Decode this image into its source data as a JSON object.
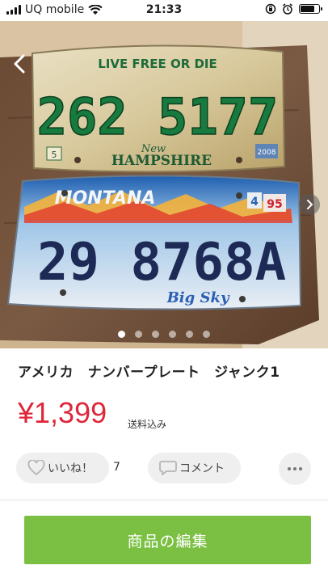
{
  "status_bar": {
    "carrier": "UQ mobile",
    "time": "21:33",
    "battery_level": 0.8
  },
  "photo": {
    "plate_top": {
      "motto": "LIVE FREE OR DIE",
      "number": "262 5177",
      "state": "HAMPSHIRE",
      "state_script": "New",
      "month": "5",
      "year_sticker": "2008"
    },
    "plate_bottom": {
      "state": "MONTANA",
      "number": "29 8768A",
      "slogan": "Big Sky",
      "sticker_month": "4",
      "sticker_year": "95"
    },
    "slide_count": 6,
    "active_slide": 1
  },
  "item": {
    "title": "アメリカ　ナンバープレート　ジャンク1",
    "price": "¥1,399",
    "shipping": "送料込み"
  },
  "actions": {
    "like_label": "いいね！",
    "like_count": "7",
    "comment_label": "コメント",
    "edit_label": "商品の編集"
  },
  "colors": {
    "price": "#e0263a",
    "primary_button": "#7bc043"
  }
}
